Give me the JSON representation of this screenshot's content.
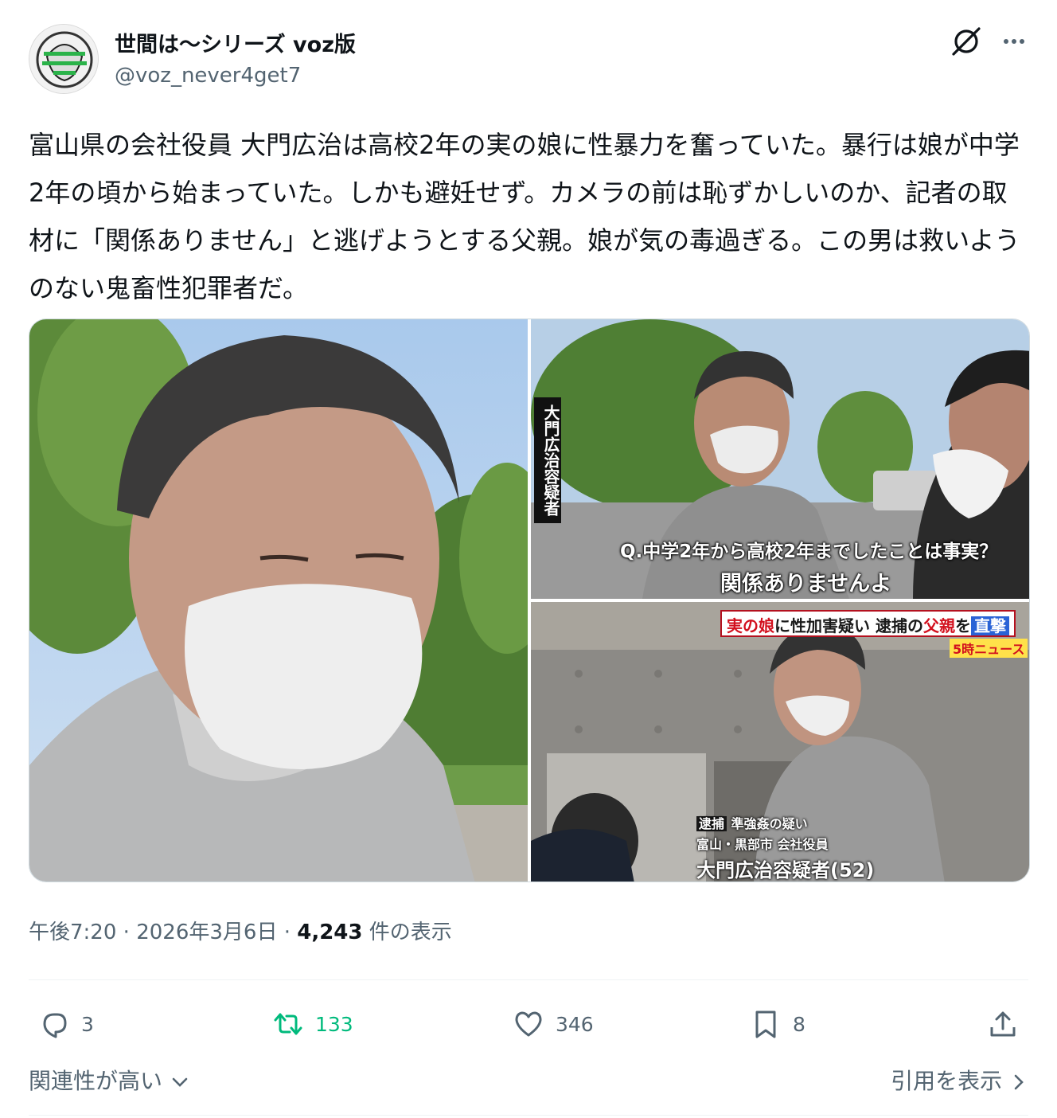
{
  "author": {
    "name": "世間は〜シリーズ voz版",
    "handle": "@voz_never4get7",
    "avatar_icon": "avatar-icon"
  },
  "header_icons": [
    "grok-icon",
    "more-icon"
  ],
  "tweet": {
    "text": "富山県の会社役員 大門広治は高校2年の実の娘に性暴力を奮っていた。暴行は娘が中学2年の頃から始まっていた。しかも避妊せず。カメラの前は恥ずかしいのか、記者の取材に「関係ありません」と逃げようとする父親。娘が気の毒過ぎる。この男は救いようのない鬼畜性犯罪者だ。"
  },
  "media": {
    "top_right": {
      "vertical_label": "大門広治容疑者",
      "question": "Q.中学2年から高校2年までしたことは事実？",
      "answer": "関係ありませんよ"
    },
    "bottom_right": {
      "headline_red": "実の娘",
      "headline_mid": "に性加害疑い 逮捕の",
      "headline_red2": "父親",
      "headline_mid2": "を",
      "headline_blue": "直撃",
      "program": "5時ニュース",
      "tag": "逮捕",
      "charge": "準強姦の疑い",
      "location": "富山・黒部市 会社役員",
      "suspect": "大門広治容疑者(52)"
    }
  },
  "meta": {
    "time": "午後7:20",
    "separator": " · ",
    "date": "2026年3月6日",
    "views_count": "4,243",
    "views_label": " 件の表示"
  },
  "actions": {
    "replies": "3",
    "retweets": "133",
    "likes": "346",
    "bookmarks": "8"
  },
  "footer": {
    "relevance": "関連性が高い",
    "quotes": "引用を表示"
  },
  "colors": {
    "text": "#0f1419",
    "secondary": "#536471",
    "retweet_green": "#00ba7c",
    "border": "#cfd9de"
  }
}
